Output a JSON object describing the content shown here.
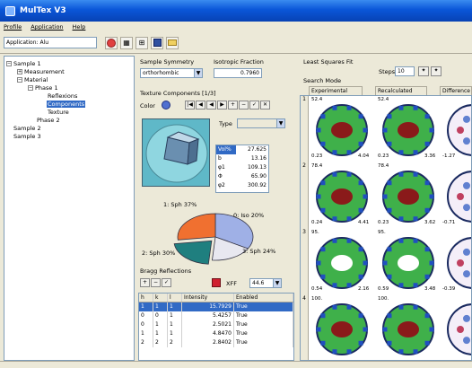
{
  "window": {
    "title": "MulTex V3"
  },
  "menu": {
    "items": [
      "Profile",
      "Application",
      "Help"
    ]
  },
  "toolbar": {
    "application_label": "Application: Alu"
  },
  "tree": {
    "items": [
      {
        "label": "Sample 1",
        "expander": "−"
      },
      {
        "label": "Measurement",
        "expander": "+"
      },
      {
        "label": "Material",
        "expander": "−"
      },
      {
        "label": "Phase 1",
        "expander": "−"
      },
      {
        "label": "Reflexions"
      },
      {
        "label": "Components"
      },
      {
        "label": "Texture"
      },
      {
        "label": "Phase 2"
      },
      {
        "label": "Sample 2"
      },
      {
        "label": "Sample 3"
      }
    ]
  },
  "sample_symmetry": {
    "label": "Sample Symmetry",
    "value": "orthorhombic"
  },
  "isotropic_fraction": {
    "label": "Isotropic Fraction",
    "value": "0.7960"
  },
  "texture_components": {
    "label": "Texture Components [1/3]",
    "color_label": "Color",
    "type_label": "Type"
  },
  "euler": {
    "rows": [
      {
        "key": "Vol%",
        "value": "27.625"
      },
      {
        "key": "b",
        "value": "13.16"
      },
      {
        "key": "φ1",
        "value": "109.13"
      },
      {
        "key": "Φ",
        "value": "65.90"
      },
      {
        "key": "φ2",
        "value": "300.92"
      }
    ]
  },
  "pie": {
    "slice_values": [
      37,
      20,
      24,
      30
    ],
    "colors": [
      "#9fb0e6",
      "#e8e8f0",
      "#1f7f7f",
      "#f07030"
    ],
    "labels": [
      "1: Sph 37%",
      "0: Iso 20%",
      "3: Sph 24%",
      "2: Sph 30%"
    ]
  },
  "bragg": {
    "label": "Bragg Reflections",
    "xff_label": "XFF",
    "xff_value": "44.6",
    "columns": [
      "h",
      "k",
      "l",
      "Intensity",
      "Enabled"
    ],
    "rows": [
      [
        "1",
        "1",
        "1",
        "15.7929",
        "True"
      ],
      [
        "0",
        "0",
        "1",
        "5.4257",
        "True"
      ],
      [
        "0",
        "1",
        "1",
        "2.5021",
        "True"
      ],
      [
        "1",
        "1",
        "1",
        "4.8470",
        "True"
      ],
      [
        "2",
        "2",
        "2",
        "2.8402",
        "True"
      ]
    ]
  },
  "least_squares": {
    "label": "Least Squares Fit",
    "steps_label": "Steps",
    "steps_value": "10"
  },
  "search_mode": {
    "label": "Search Mode"
  },
  "pf_columns": [
    "Experimental",
    "Recalculated",
    "Difference"
  ],
  "pf_rows": [
    {
      "num": "1",
      "cells": [
        {
          "top": "52.4",
          "bl": "0.23",
          "br": "4.04"
        },
        {
          "top": "52.4",
          "bl": "0.23",
          "br": "3.36"
        },
        {
          "top": "",
          "bl": "-1.27",
          "br": ""
        }
      ]
    },
    {
      "num": "2",
      "cells": [
        {
          "top": "78.4",
          "bl": "0.24",
          "br": "4.41"
        },
        {
          "top": "78.4",
          "bl": "0.23",
          "br": "3.62"
        },
        {
          "top": "",
          "bl": "-0.71",
          "br": ""
        }
      ]
    },
    {
      "num": "3",
      "cells": [
        {
          "top": "95.",
          "bl": "0.54",
          "br": "2.16"
        },
        {
          "top": "95.",
          "bl": "0.59",
          "br": "3.48"
        },
        {
          "top": "",
          "bl": "-0.39",
          "br": ""
        }
      ]
    },
    {
      "num": "4",
      "cells": [
        {
          "top": "100.",
          "bl": "",
          "br": ""
        },
        {
          "top": "100.",
          "bl": "",
          "br": ""
        },
        {
          "top": "",
          "bl": "",
          "br": ""
        }
      ]
    }
  ]
}
